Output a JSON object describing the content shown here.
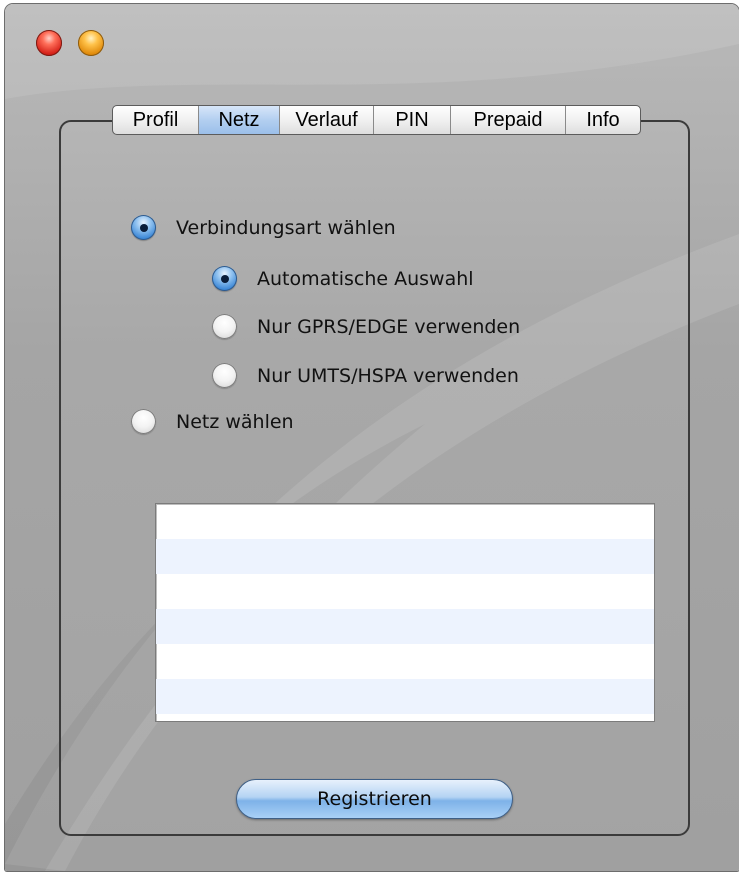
{
  "window": {
    "controls": [
      "close",
      "minimize"
    ]
  },
  "tabs": [
    {
      "label": "Profil",
      "selected": false
    },
    {
      "label": "Netz",
      "selected": true
    },
    {
      "label": "Verlauf",
      "selected": false
    },
    {
      "label": "PIN",
      "selected": false
    },
    {
      "label": "Prepaid",
      "selected": false
    },
    {
      "label": "Info",
      "selected": false
    }
  ],
  "options": {
    "connection_type": {
      "label": "Verbindungsart wählen",
      "selected": true
    },
    "automatic": {
      "label": "Automatische Auswahl",
      "selected": true
    },
    "gprs_edge": {
      "label": "Nur GPRS/EDGE verwenden",
      "selected": false
    },
    "umts_hspa": {
      "label": "Nur UMTS/HSPA verwenden",
      "selected": false
    },
    "choose_network": {
      "label": "Netz wählen",
      "selected": false
    }
  },
  "network_list": {
    "rows": [
      "",
      "",
      "",
      "",
      "",
      ""
    ]
  },
  "register_button": {
    "label": "Registrieren"
  },
  "colors": {
    "accent": "#3a86d6",
    "list_alt_row": "#edf3fe"
  }
}
